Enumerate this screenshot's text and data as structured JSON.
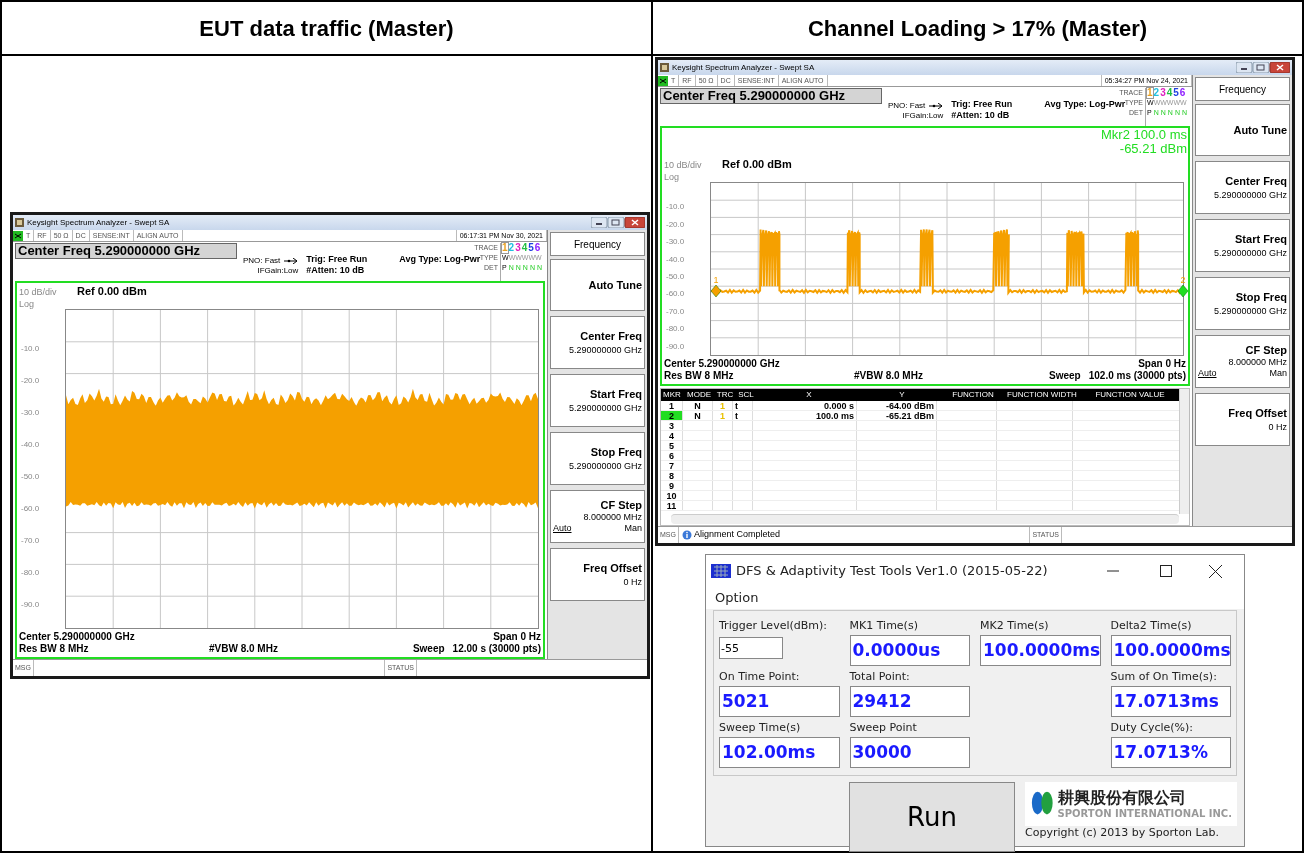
{
  "columns": [
    {
      "heading": "EUT data traffic (Master)"
    },
    {
      "heading": "Channel Loading > 17% (Master)"
    }
  ],
  "analyzers": [
    {
      "title": "Keysight Spectrum Analyzer - Swept SA",
      "status_items": [
        "T",
        "RF",
        "50 Ω",
        "DC",
        "SENSE:INT",
        "ALIGN AUTO",
        "06:17:31 PM Nov 30, 2021"
      ],
      "center_freq": "Center Freq 5.290000000 GHz",
      "pno": "PNO: Fast",
      "ifgain": "IFGain:Low",
      "trig": "Trig: Free Run",
      "atten": "#Atten: 10 dB",
      "avg_type": "Avg Type: Log-Pwr",
      "trace_labels": [
        "TRACE",
        "TYPE",
        "DET"
      ],
      "traces": [
        {
          "label": "1",
          "color": "#e8a020",
          "selected": true,
          "type": "W",
          "det": "P"
        },
        {
          "label": "2",
          "color": "#20c0e0",
          "selected": false,
          "type": "W",
          "det": "N"
        },
        {
          "label": "3",
          "color": "#e020c0",
          "selected": false,
          "type": "W",
          "det": "N"
        },
        {
          "label": "4",
          "color": "#20c040",
          "selected": false,
          "type": "W",
          "det": "N"
        },
        {
          "label": "5",
          "color": "#2040e0",
          "selected": false,
          "type": "W",
          "det": "N"
        },
        {
          "label": "6",
          "color": "#9020ff",
          "selected": false,
          "type": "W",
          "det": "N"
        }
      ],
      "scale": "10 dB/div",
      "ref": "Ref 0.00 dBm",
      "log": "Log",
      "y_labels": [
        "-10.0",
        "-20.0",
        "-30.0",
        "-40.0",
        "-50.0",
        "-60.0",
        "-70.0",
        "-80.0",
        "-90.0"
      ],
      "footer": {
        "center": "Center 5.290000000 GHz",
        "span": "Span 0 Hz",
        "res_bw": "Res BW 8 MHz",
        "vbw": "#VBW 8.0 MHz",
        "sweep_label": "Sweep",
        "sweep": "12.00 s (30000 pts)"
      },
      "softkeys": [
        {
          "kind": "title",
          "label": "Frequency"
        },
        {
          "kind": "action",
          "label": "Auto Tune"
        },
        {
          "kind": "value",
          "label": "Center Freq",
          "value": "5.290000000 GHz"
        },
        {
          "kind": "value",
          "label": "Start Freq",
          "value": "5.290000000 GHz"
        },
        {
          "kind": "value",
          "label": "Stop Freq",
          "value": "5.290000000 GHz"
        },
        {
          "kind": "toggle",
          "label": "CF Step",
          "value": "8.000000 MHz",
          "options": [
            {
              "label": "Auto",
              "selected": true
            },
            {
              "label": "Man",
              "selected": false
            }
          ]
        },
        {
          "kind": "value",
          "label": "Freq Offset",
          "value": "0 Hz"
        }
      ],
      "msg_label": "MSG",
      "status_label": "STATUS"
    },
    {
      "title": "Keysight Spectrum Analyzer - Swept SA",
      "status_items": [
        "T",
        "RF",
        "50 Ω",
        "DC",
        "SENSE:INT",
        "ALIGN AUTO",
        "05:34:27 PM Nov 24, 2021"
      ],
      "center_freq": "Center Freq 5.290000000 GHz",
      "pno": "PNO: Fast",
      "ifgain": "IFGain:Low",
      "trig": "Trig: Free Run",
      "atten": "#Atten: 10 dB",
      "avg_type": "Avg Type: Log-Pwr",
      "trace_labels": [
        "TRACE",
        "TYPE",
        "DET"
      ],
      "traces": [
        {
          "label": "1",
          "color": "#e8a020",
          "selected": true,
          "type": "W",
          "det": "P"
        },
        {
          "label": "2",
          "color": "#20c0e0",
          "selected": false,
          "type": "W",
          "det": "N"
        },
        {
          "label": "3",
          "color": "#e020c0",
          "selected": false,
          "type": "W",
          "det": "N"
        },
        {
          "label": "4",
          "color": "#20c040",
          "selected": false,
          "type": "W",
          "det": "N"
        },
        {
          "label": "5",
          "color": "#2040e0",
          "selected": false,
          "type": "W",
          "det": "N"
        },
        {
          "label": "6",
          "color": "#9020ff",
          "selected": false,
          "type": "W",
          "det": "N"
        }
      ],
      "marker_readout": [
        "Mkr2 100.0 ms",
        "-65.21 dBm"
      ],
      "scale": "10 dB/div",
      "ref": "Ref 0.00 dBm",
      "log": "Log",
      "y_labels": [
        "-10.0",
        "-20.0",
        "-30.0",
        "-40.0",
        "-50.0",
        "-60.0",
        "-70.0",
        "-80.0",
        "-90.0"
      ],
      "plot_markers": [
        {
          "label": "1",
          "selected": false
        },
        {
          "label": "2",
          "selected": true
        }
      ],
      "footer": {
        "center": "Center 5.290000000 GHz",
        "span": "Span 0 Hz",
        "res_bw": "Res BW 8 MHz",
        "vbw": "#VBW 8.0 MHz",
        "sweep_label": "Sweep",
        "sweep": "102.0 ms (30000 pts)"
      },
      "marker_table": {
        "columns": [
          "MKR",
          "MODE",
          "TRC",
          "SCL",
          "X",
          "Y",
          "FUNCTION",
          "FUNCTION WIDTH",
          "FUNCTION VALUE"
        ],
        "rows": [
          {
            "mkr": "1",
            "mode": "N",
            "trc": "1",
            "scl": "t",
            "x": "0.000 s",
            "y": "-64.00 dBm",
            "selected": false
          },
          {
            "mkr": "2",
            "mode": "N",
            "trc": "1",
            "scl": "t",
            "x": "100.0 ms",
            "y": "-65.21 dBm",
            "selected": true
          },
          {
            "mkr": "3",
            "selected": false
          },
          {
            "mkr": "4",
            "selected": false
          },
          {
            "mkr": "5",
            "selected": false
          },
          {
            "mkr": "6",
            "selected": false
          },
          {
            "mkr": "7",
            "selected": false
          },
          {
            "mkr": "8",
            "selected": false
          },
          {
            "mkr": "9",
            "selected": false
          },
          {
            "mkr": "10",
            "selected": false
          },
          {
            "mkr": "11",
            "selected": false
          }
        ]
      },
      "softkeys": [
        {
          "kind": "title",
          "label": "Frequency"
        },
        {
          "kind": "action",
          "label": "Auto Tune"
        },
        {
          "kind": "value",
          "label": "Center Freq",
          "value": "5.290000000 GHz"
        },
        {
          "kind": "value",
          "label": "Start Freq",
          "value": "5.290000000 GHz"
        },
        {
          "kind": "value",
          "label": "Stop Freq",
          "value": "5.290000000 GHz"
        },
        {
          "kind": "toggle",
          "label": "CF Step",
          "value": "8.000000 MHz",
          "options": [
            {
              "label": "Auto",
              "selected": true
            },
            {
              "label": "Man",
              "selected": false
            }
          ]
        },
        {
          "kind": "value",
          "label": "Freq Offset",
          "value": "0 Hz"
        }
      ],
      "msg_label": "MSG",
      "message": "Alignment Completed",
      "status_label": "STATUS"
    }
  ],
  "tool": {
    "title": "DFS & Adaptivity Test Tools Ver1.0 (2015-05-22)",
    "menu": [
      "Option"
    ],
    "rows": [
      [
        {
          "kind": "input",
          "label": "Trigger Level(dBm):",
          "value": "-55"
        },
        {
          "kind": "readout",
          "label": "MK1 Time(s)",
          "value": "0.0000us"
        },
        {
          "kind": "readout",
          "label": "MK2 Time(s)",
          "value": "100.0000ms"
        },
        {
          "kind": "readout",
          "label": "Delta2 Time(s)",
          "value": "100.0000ms"
        }
      ],
      [
        {
          "kind": "readout",
          "label": "On Time Point:",
          "value": "5021"
        },
        {
          "kind": "readout",
          "label": "Total Point:",
          "value": "29412"
        },
        null,
        {
          "kind": "readout",
          "label": "Sum of On Time(s):",
          "value": "17.0713ms"
        }
      ],
      [
        {
          "kind": "readout",
          "label": "Sweep Time(s)",
          "value": "102.00ms"
        },
        {
          "kind": "readout",
          "label": "Sweep Point",
          "value": "30000"
        },
        null,
        {
          "kind": "readout",
          "label": "Duty Cycle(%):",
          "value": "17.0713%"
        }
      ]
    ],
    "run_button": "Run",
    "company_chinese": "耕興股份有限公司",
    "company_english": "SPORTON INTERNATIONAL INC.",
    "copyright": "Copyright (c) 2013 by Sporton Lab."
  }
}
